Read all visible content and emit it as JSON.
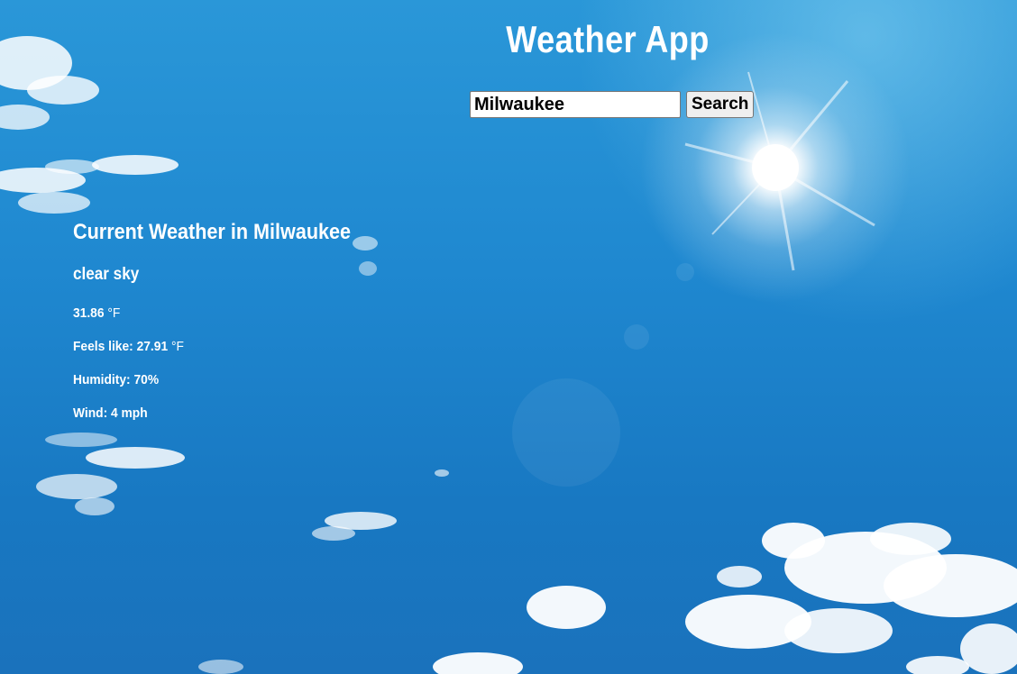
{
  "app": {
    "title": "Weather App"
  },
  "search": {
    "value": "Milwaukee",
    "button_label": "Search"
  },
  "weather": {
    "heading": "Current Weather in Milwaukee",
    "description": "clear sky",
    "temperature_value": "31.86",
    "temperature_unit": "°F",
    "feels_like_label": "Feels like:",
    "feels_like_value": "27.91",
    "feels_like_unit": "°F",
    "humidity": "Humidity: 70%",
    "wind": "Wind: 4 mph"
  },
  "colors": {
    "sky_top": "#2a97d8",
    "sky_bottom": "#1a72bc",
    "text": "#ffffff"
  }
}
